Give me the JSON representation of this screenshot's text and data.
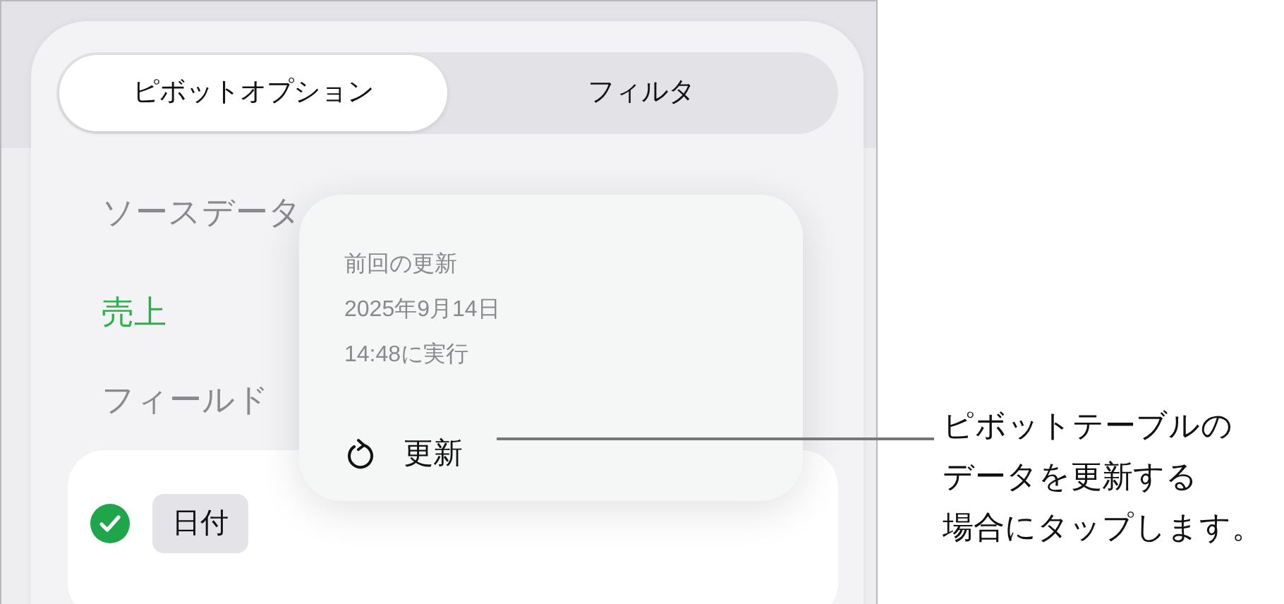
{
  "tabs": [
    {
      "label": "ピボットオプション",
      "selected": true
    },
    {
      "label": "フィルタ",
      "selected": false
    }
  ],
  "source_data": {
    "label": "ソースデータ",
    "value": "売上"
  },
  "fields": {
    "label": "フィールド",
    "items": [
      {
        "label": "日付",
        "checked": true
      }
    ]
  },
  "popover": {
    "heading": "前回の更新",
    "date": "2025年9月14日",
    "time": "14:48に実行",
    "refresh_button": "更新"
  },
  "callout": {
    "lines": [
      "ピボットテーブルの",
      "データを更新する",
      "場合にタップします。"
    ]
  }
}
